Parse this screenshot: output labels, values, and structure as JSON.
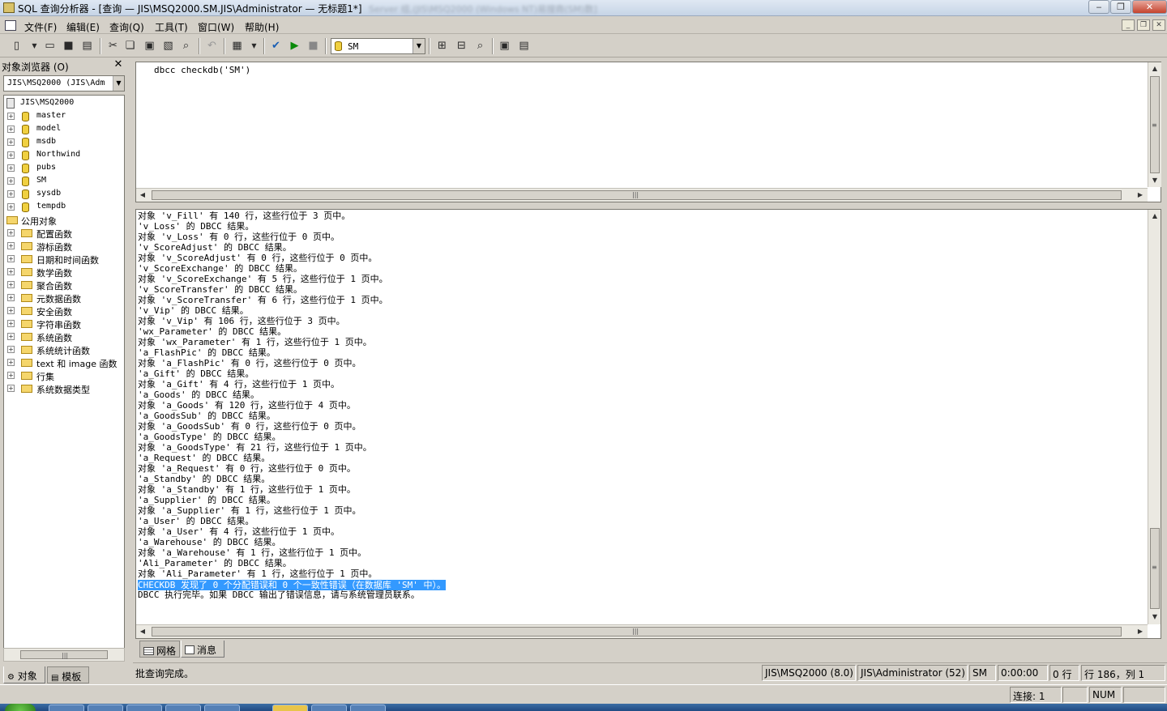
{
  "window": {
    "title": "SQL 查询分析器 - [查询 — JIS\\MSQ2000.SM.JIS\\Administrator — 无标题1*]",
    "ghost_title": "Server 组,(JIS\\MSQ2000 (Windows NT)易搜商(SM)数]",
    "min": "‒",
    "max": "❐",
    "close": "✕"
  },
  "menu": {
    "file": "文件(F)",
    "edit": "编辑(E)",
    "query": "查询(Q)",
    "tools": "工具(T)",
    "window": "窗口(W)",
    "help": "帮助(H)"
  },
  "toolbar": {
    "database": "SM"
  },
  "object_browser": {
    "title": "对象浏览器 (O)",
    "close": "✕",
    "server_combo": "JIS\\MSQ2000 (JIS\\Adm",
    "server": "JIS\\MSQ2000",
    "databases": [
      "master",
      "model",
      "msdb",
      "Northwind",
      "pubs",
      "SM",
      "sysdb",
      "tempdb"
    ],
    "common_objects": "公用对象",
    "folders": [
      "配置函数",
      "游标函数",
      "日期和时间函数",
      "数学函数",
      "聚合函数",
      "元数据函数",
      "安全函数",
      "字符串函数",
      "系统函数",
      "系统统计函数",
      "text 和 image 函数",
      "行集",
      "系统数据类型"
    ],
    "tabs": [
      "对象",
      "模板"
    ]
  },
  "editor": {
    "code": "dbcc checkdb('SM')"
  },
  "results": {
    "lines": [
      "对象 'v_Fill' 有 140 行，这些行位于 3 页中。",
      "'v_Loss' 的 DBCC 结果。",
      "对象 'v_Loss' 有 0 行，这些行位于 0 页中。",
      "'v_ScoreAdjust' 的 DBCC 结果。",
      "对象 'v_ScoreAdjust' 有 0 行，这些行位于 0 页中。",
      "'v_ScoreExchange' 的 DBCC 结果。",
      "对象 'v_ScoreExchange' 有 5 行，这些行位于 1 页中。",
      "'v_ScoreTransfer' 的 DBCC 结果。",
      "对象 'v_ScoreTransfer' 有 6 行，这些行位于 1 页中。",
      "'v_Vip' 的 DBCC 结果。",
      "对象 'v_Vip' 有 106 行，这些行位于 3 页中。",
      "'wx_Parameter' 的 DBCC 结果。",
      "对象 'wx_Parameter' 有 1 行，这些行位于 1 页中。",
      "'a_FlashPic' 的 DBCC 结果。",
      "对象 'a_FlashPic' 有 0 行，这些行位于 0 页中。",
      "'a_Gift' 的 DBCC 结果。",
      "对象 'a_Gift' 有 4 行，这些行位于 1 页中。",
      "'a_Goods' 的 DBCC 结果。",
      "对象 'a_Goods' 有 120 行，这些行位于 4 页中。",
      "'a_GoodsSub' 的 DBCC 结果。",
      "对象 'a_GoodsSub' 有 0 行，这些行位于 0 页中。",
      "'a_GoodsType' 的 DBCC 结果。",
      "对象 'a_GoodsType' 有 21 行，这些行位于 1 页中。",
      "'a_Request' 的 DBCC 结果。",
      "对象 'a_Request' 有 0 行，这些行位于 0 页中。",
      "'a_Standby' 的 DBCC 结果。",
      "对象 'a_Standby' 有 1 行，这些行位于 1 页中。",
      "'a_Supplier' 的 DBCC 结果。",
      "对象 'a_Supplier' 有 1 行，这些行位于 1 页中。",
      "'a_User' 的 DBCC 结果。",
      "对象 'a_User' 有 4 行，这些行位于 1 页中。",
      "'a_Warehouse' 的 DBCC 结果。",
      "对象 'a_Warehouse' 有 1 行，这些行位于 1 页中。",
      "'Ali_Parameter' 的 DBCC 结果。",
      "对象 'Ali_Parameter' 有 1 行，这些行位于 1 页中。"
    ],
    "highlight": "CHECKDB 发现了 0 个分配错误和 0 个一致性错误（在数据库 'SM' 中）。",
    "final": "DBCC 执行完毕。如果 DBCC 输出了错误信息，请与系统管理员联系。",
    "tabs": [
      "网格",
      "消息"
    ]
  },
  "query_status": {
    "message": "批查询完成。",
    "server": "JIS\\MSQ2000 (8.0)",
    "user": "JIS\\Administrator (52)",
    "database": "SM",
    "elapsed": "0:00:00",
    "rows": "0 行",
    "position": "行 186，列 1"
  },
  "app_status": {
    "connections": "连接: 1",
    "num": "NUM"
  }
}
